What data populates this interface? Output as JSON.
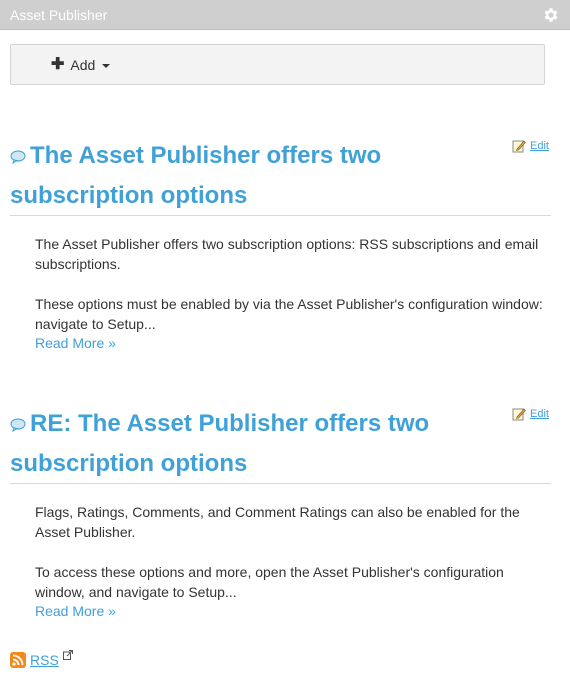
{
  "portlet": {
    "title": "Asset Publisher",
    "settings_icon": "gear-icon"
  },
  "toolbar": {
    "add_label": "Add"
  },
  "entries": [
    {
      "title": "The Asset Publisher offers two subscription options",
      "edit_label": "Edit",
      "summary": [
        "The Asset Publisher offers two subscription options: RSS subscriptions and email subscriptions.",
        "These options must be enabled by via the Asset Publisher's configuration window: navigate to Setup..."
      ],
      "read_more": "Read More »"
    },
    {
      "title": "RE: The Asset Publisher offers two subscription options",
      "edit_label": "Edit",
      "summary": [
        "Flags, Ratings, Comments, and Comment Ratings can also be enabled for the Asset Publisher.",
        "To access these options and more, open the Asset Publisher's configuration window, and navigate to Setup..."
      ],
      "read_more": "Read More »"
    }
  ],
  "footer": {
    "rss_label": "RSS"
  },
  "colors": {
    "link": "#3fa1d8",
    "header_bg": "#cfcfcf"
  }
}
